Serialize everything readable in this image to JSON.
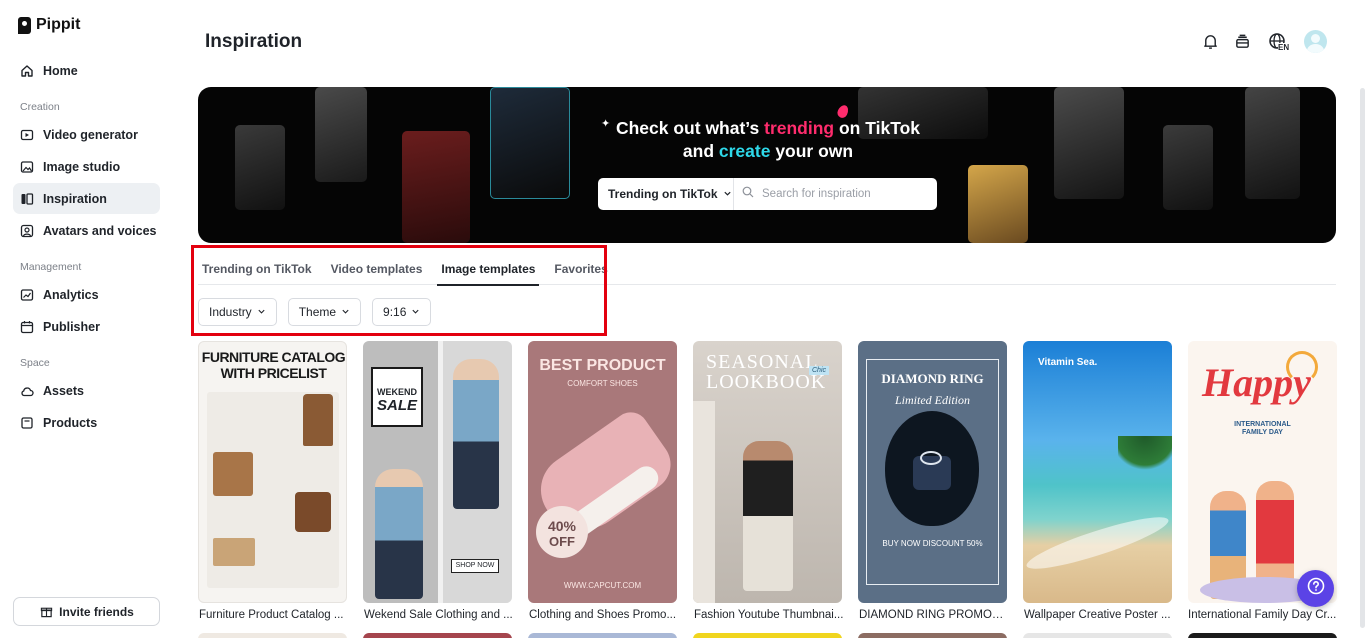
{
  "app": {
    "name": "Pippit"
  },
  "sidebar": {
    "home": "Home",
    "creation_label": "Creation",
    "creation_items": [
      "Video generator",
      "Image studio",
      "Inspiration",
      "Avatars and voices"
    ],
    "management_label": "Management",
    "management_items": [
      "Analytics",
      "Publisher"
    ],
    "space_label": "Space",
    "space_items": [
      "Assets",
      "Products"
    ],
    "invite": "Invite friends"
  },
  "header": {
    "title": "Inspiration",
    "language": "EN"
  },
  "banner": {
    "line1_pre": "Check out what’s ",
    "line1_highlight": "trending",
    "line1_post": " on TikTok",
    "line2_pre": "and ",
    "line2_highlight": "create",
    "line2_post": " your own",
    "search_select": "Trending on TikTok",
    "search_placeholder": "Search for inspiration"
  },
  "tabs": [
    "Trending on TikTok",
    "Video templates",
    "Image templates",
    "Favorites"
  ],
  "active_tab": "Image templates",
  "filters": [
    "Industry",
    "Theme",
    "9:16"
  ],
  "cards": [
    {
      "title": "Furniture Product Catalog ...",
      "lines": [
        "FURNITURE CATALOG",
        "WITH PRICELIST"
      ]
    },
    {
      "title": "Wekend Sale Clothing and ...",
      "lines": [
        "WEKEND",
        "SALE",
        "SHOP NOW"
      ]
    },
    {
      "title": "Clothing and Shoes Promo...",
      "lines": [
        "BEST PRODUCT",
        "COMFORT SHOES",
        "40%",
        "OFF",
        "WWW.CAPCUT.COM"
      ]
    },
    {
      "title": "Fashion Youtube Thumbnai...",
      "lines": [
        "SEASONAL",
        "LOOKBOOK",
        "Chic"
      ]
    },
    {
      "title": "DIAMOND RING PROMOTI...",
      "lines": [
        "DIAMOND RING",
        "Limited Edition",
        "BUY NOW DISCOUNT 50%"
      ]
    },
    {
      "title": "Wallpaper Creative Poster ...",
      "lines": [
        "Vitamin Sea."
      ]
    },
    {
      "title": "International Family Day Cr...",
      "lines": [
        "Happy",
        "INTERNATIONAL",
        "FAMILY DAY"
      ]
    }
  ],
  "colors": {
    "accent": "#1f2329",
    "highlight_box": "#e3000f",
    "pink": "#ff2c6d",
    "cyan": "#2ed8e9",
    "help": "#5b43e6"
  }
}
